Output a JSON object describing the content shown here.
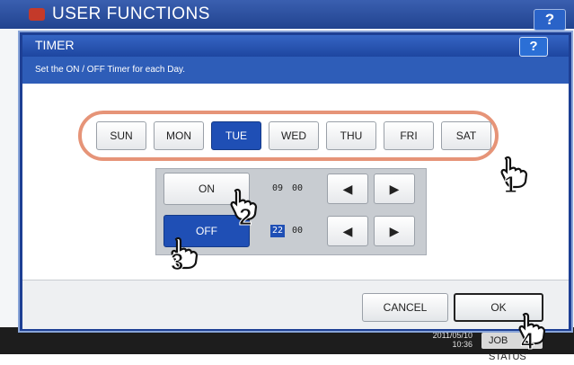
{
  "background": {
    "title": "USER FUNCTIONS",
    "help_label": "?",
    "clock_date": "2011/05/10",
    "clock_time": "10:36",
    "job_label": "JOB STATUS"
  },
  "dialog": {
    "title": "TIMER",
    "help_label": "?",
    "instruction": "Set the ON / OFF Timer for each Day."
  },
  "days": [
    {
      "label": "SUN",
      "selected": false
    },
    {
      "label": "MON",
      "selected": false
    },
    {
      "label": "TUE",
      "selected": true
    },
    {
      "label": "WED",
      "selected": false
    },
    {
      "label": "THU",
      "selected": false
    },
    {
      "label": "FRI",
      "selected": false
    },
    {
      "label": "SAT",
      "selected": false
    }
  ],
  "timer": {
    "on": {
      "label": "ON",
      "hour": "09",
      "minute": "00",
      "selected": false
    },
    "off": {
      "label": "OFF",
      "hour": "22",
      "minute": "00",
      "selected": true,
      "hour_highlighted": true
    },
    "arrow_left": "◀",
    "arrow_right": "▶"
  },
  "footer": {
    "cancel_label": "CANCEL",
    "ok_label": "OK"
  },
  "markers": [
    "1",
    "2",
    "3",
    "4"
  ],
  "colors": {
    "accent": "#1f4fb5",
    "highlight_ring": "#e69478"
  }
}
